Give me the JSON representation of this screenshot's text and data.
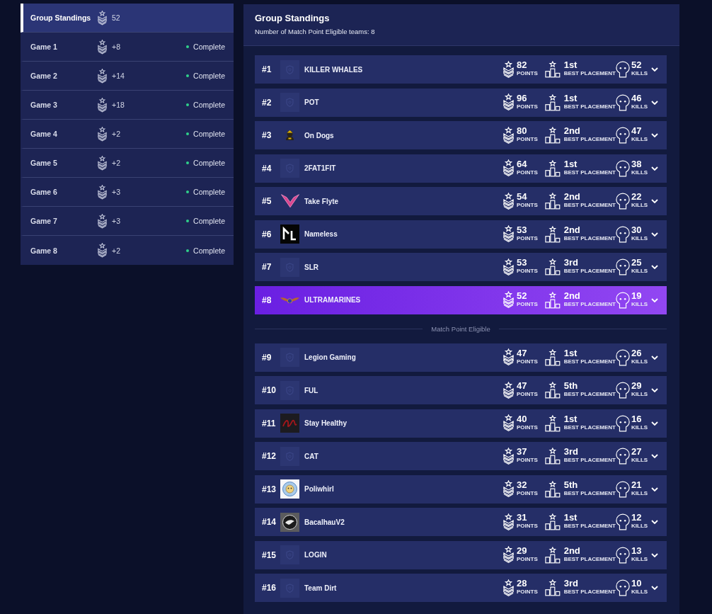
{
  "sidebar": {
    "items": [
      {
        "label": "Group Standings",
        "points": "52",
        "selected": true
      },
      {
        "label": "Game 1",
        "points": "+8",
        "status": "Complete",
        "selected": false
      },
      {
        "label": "Game 2",
        "points": "+14",
        "status": "Complete",
        "selected": false
      },
      {
        "label": "Game 3",
        "points": "+18",
        "status": "Complete",
        "selected": false
      },
      {
        "label": "Game 4",
        "points": "+2",
        "status": "Complete",
        "selected": false
      },
      {
        "label": "Game 5",
        "points": "+2",
        "status": "Complete",
        "selected": false
      },
      {
        "label": "Game 6",
        "points": "+3",
        "status": "Complete",
        "selected": false
      },
      {
        "label": "Game 7",
        "points": "+3",
        "status": "Complete",
        "selected": false
      },
      {
        "label": "Game 8",
        "points": "+2",
        "status": "Complete",
        "selected": false
      }
    ]
  },
  "standings": {
    "title": "Group Standings",
    "subtitle": "Number of Match Point Eligible teams: 8",
    "rows": [
      {
        "kind": "team",
        "rank": "#1",
        "name": "KILLER WHALES",
        "logo": {
          "kind": "placeholder"
        },
        "highlighted": false,
        "points": "82",
        "points_label": "POINTS",
        "placement": "1st",
        "placement_label": "BEST PLACEMENT",
        "kills": "52",
        "kills_label": "KILLS"
      },
      {
        "kind": "team",
        "rank": "#2",
        "name": "POT",
        "logo": {
          "kind": "placeholder"
        },
        "highlighted": false,
        "points": "96",
        "points_label": "POINTS",
        "placement": "1st",
        "placement_label": "BEST PLACEMENT",
        "kills": "46",
        "kills_label": "KILLS"
      },
      {
        "kind": "team",
        "rank": "#3",
        "name": "On Dogs",
        "logo": {
          "kind": "figure"
        },
        "highlighted": false,
        "points": "80",
        "points_label": "POINTS",
        "placement": "2nd",
        "placement_label": "BEST PLACEMENT",
        "kills": "47",
        "kills_label": "KILLS"
      },
      {
        "kind": "team",
        "rank": "#4",
        "name": "2FAT1FIT",
        "logo": {
          "kind": "placeholder"
        },
        "highlighted": false,
        "points": "64",
        "points_label": "POINTS",
        "placement": "1st",
        "placement_label": "BEST PLACEMENT",
        "kills": "38",
        "kills_label": "KILLS"
      },
      {
        "kind": "team",
        "rank": "#5",
        "name": "Take Flyte",
        "logo": {
          "kind": "wings"
        },
        "highlighted": false,
        "points": "54",
        "points_label": "POINTS",
        "placement": "2nd",
        "placement_label": "BEST PLACEMENT",
        "kills": "22",
        "kills_label": "KILLS"
      },
      {
        "kind": "team",
        "rank": "#6",
        "name": "Nameless",
        "logo": {
          "kind": "monogram"
        },
        "highlighted": false,
        "points": "53",
        "points_label": "POINTS",
        "placement": "2nd",
        "placement_label": "BEST PLACEMENT",
        "kills": "30",
        "kills_label": "KILLS"
      },
      {
        "kind": "team",
        "rank": "#7",
        "name": "SLR",
        "logo": {
          "kind": "placeholder"
        },
        "highlighted": false,
        "points": "53",
        "points_label": "POINTS",
        "placement": "3rd",
        "placement_label": "BEST PLACEMENT",
        "kills": "25",
        "kills_label": "KILLS"
      },
      {
        "kind": "team",
        "rank": "#8",
        "name": "ULTRAMARINES",
        "logo": {
          "kind": "winged-crest"
        },
        "highlighted": true,
        "points": "52",
        "points_label": "POINTS",
        "placement": "2nd",
        "placement_label": "BEST PLACEMENT",
        "kills": "19",
        "kills_label": "KILLS"
      },
      {
        "kind": "divider",
        "label": "Match Point Eligible"
      },
      {
        "kind": "team",
        "rank": "#9",
        "name": "Legion Gaming",
        "logo": {
          "kind": "placeholder"
        },
        "highlighted": false,
        "points": "47",
        "points_label": "POINTS",
        "placement": "1st",
        "placement_label": "BEST PLACEMENT",
        "kills": "26",
        "kills_label": "KILLS"
      },
      {
        "kind": "team",
        "rank": "#10",
        "name": "FUL",
        "logo": {
          "kind": "placeholder"
        },
        "highlighted": false,
        "points": "47",
        "points_label": "POINTS",
        "placement": "5th",
        "placement_label": "BEST PLACEMENT",
        "kills": "29",
        "kills_label": "KILLS"
      },
      {
        "kind": "team",
        "rank": "#11",
        "name": "Stay Healthy",
        "logo": {
          "kind": "scribble"
        },
        "highlighted": false,
        "points": "40",
        "points_label": "POINTS",
        "placement": "1st",
        "placement_label": "BEST PLACEMENT",
        "kills": "16",
        "kills_label": "KILLS"
      },
      {
        "kind": "team",
        "rank": "#12",
        "name": "CAT",
        "logo": {
          "kind": "placeholder"
        },
        "highlighted": false,
        "points": "37",
        "points_label": "POINTS",
        "placement": "3rd",
        "placement_label": "BEST PLACEMENT",
        "kills": "27",
        "kills_label": "KILLS"
      },
      {
        "kind": "team",
        "rank": "#13",
        "name": "Poliwhirl",
        "logo": {
          "kind": "swirl"
        },
        "highlighted": false,
        "points": "32",
        "points_label": "POINTS",
        "placement": "5th",
        "placement_label": "BEST PLACEMENT",
        "kills": "21",
        "kills_label": "KILLS"
      },
      {
        "kind": "team",
        "rank": "#14",
        "name": "BacalhauV2",
        "logo": {
          "kind": "emblem"
        },
        "highlighted": false,
        "points": "31",
        "points_label": "POINTS",
        "placement": "1st",
        "placement_label": "BEST PLACEMENT",
        "kills": "12",
        "kills_label": "KILLS"
      },
      {
        "kind": "team",
        "rank": "#15",
        "name": "LOGIN",
        "logo": {
          "kind": "placeholder"
        },
        "highlighted": false,
        "points": "29",
        "points_label": "POINTS",
        "placement": "2nd",
        "placement_label": "BEST PLACEMENT",
        "kills": "13",
        "kills_label": "KILLS"
      },
      {
        "kind": "team",
        "rank": "#16",
        "name": "Team Dirt",
        "logo": {
          "kind": "placeholder"
        },
        "highlighted": false,
        "points": "28",
        "points_label": "POINTS",
        "placement": "3rd",
        "placement_label": "BEST PLACEMENT",
        "kills": "10",
        "kills_label": "KILLS"
      }
    ]
  }
}
